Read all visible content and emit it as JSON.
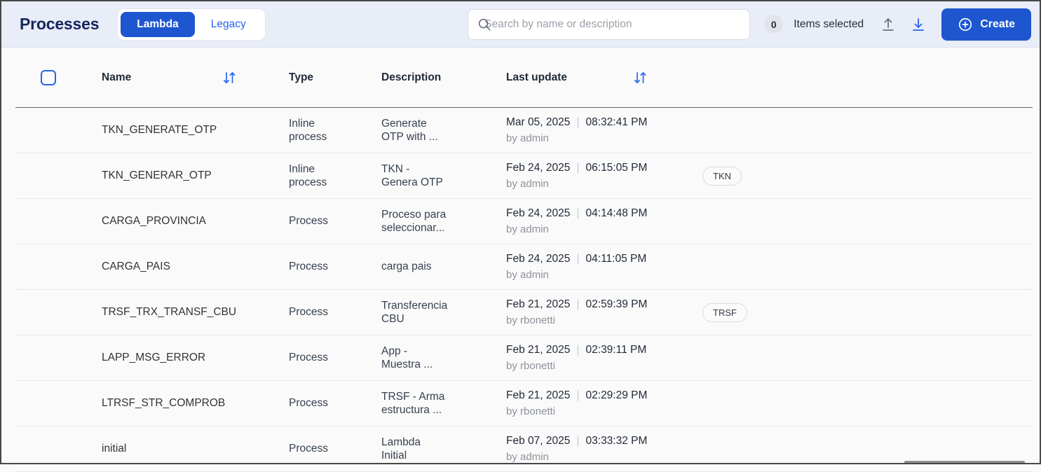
{
  "header": {
    "title": "Processes",
    "toggle": {
      "lambda_label": "Lambda",
      "legacy_label": "Legacy",
      "active": "Lambda"
    },
    "search": {
      "placeholder": "Search by name or description"
    },
    "selection": {
      "count": "0",
      "label": "Items selected"
    },
    "create_label": "Create"
  },
  "icons": {
    "search": "magnifier",
    "upload": "arrow-up-from-line",
    "download": "arrow-down-to-line",
    "create": "plus-circle",
    "sort": "down-up-arrows",
    "select_all": "empty-checkbox"
  },
  "table": {
    "columns": {
      "name": "Name",
      "type": "Type",
      "description": "Description",
      "last_update": "Last update"
    },
    "time_separator": "|",
    "rows": [
      {
        "name": "TKN_GENERATE_OTP",
        "type": "Inline\nprocess",
        "description": "Generate\nOTP with ...",
        "date": "Mar 05, 2025",
        "time": "08:32:41 PM",
        "by": "by admin",
        "badge": ""
      },
      {
        "name": "TKN_GENERAR_OTP",
        "type": "Inline\nprocess",
        "description": "TKN -\nGenera OTP",
        "date": "Feb 24, 2025",
        "time": "06:15:05 PM",
        "by": "by admin",
        "badge": "TKN"
      },
      {
        "name": "CARGA_PROVINCIA",
        "type": "Process",
        "description": "Proceso para\nseleccionar...",
        "date": "Feb 24, 2025",
        "time": "04:14:48 PM",
        "by": "by admin",
        "badge": ""
      },
      {
        "name": "CARGA_PAIS",
        "type": "Process",
        "description": "carga pais",
        "date": "Feb 24, 2025",
        "time": "04:11:05 PM",
        "by": "by admin",
        "badge": ""
      },
      {
        "name": "TRSF_TRX_TRANSF_CBU",
        "type": "Process",
        "description": "Transferencia\nCBU",
        "date": "Feb 21, 2025",
        "time": "02:59:39 PM",
        "by": "by rbonetti",
        "badge": "TRSF"
      },
      {
        "name": "LAPP_MSG_ERROR",
        "type": "Process",
        "description": "App -\nMuestra ...",
        "date": "Feb 21, 2025",
        "time": "02:39:11 PM",
        "by": "by rbonetti",
        "badge": ""
      },
      {
        "name": "LTRSF_STR_COMPROB",
        "type": "Process",
        "description": "TRSF - Arma\nestructura ...",
        "date": "Feb 21, 2025",
        "time": "02:29:29 PM",
        "by": "by rbonetti",
        "badge": ""
      },
      {
        "name": "initial",
        "type": "Process",
        "description": "Lambda\nInitial",
        "date": "Feb 07, 2025",
        "time": "03:33:32 PM",
        "by": "by admin",
        "badge": ""
      }
    ]
  },
  "colors": {
    "accent_blue": "#1e56d0",
    "link_blue": "#2563eb",
    "header_bg": "#e9edf8",
    "title_navy": "#16265c",
    "table_bg": "#fafafa",
    "muted_text": "#8d929b"
  }
}
